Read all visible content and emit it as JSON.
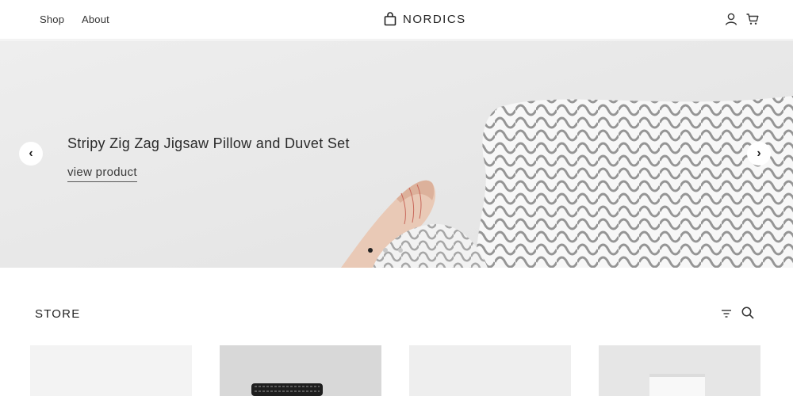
{
  "header": {
    "nav": [
      "Shop",
      "About"
    ],
    "brand": "NORDICS",
    "icons": [
      "shopping-bag-icon",
      "user-icon",
      "cart-icon"
    ]
  },
  "hero": {
    "title": "Stripy Zig Zag Jigsaw Pillow and Duvet Set",
    "link": "view product",
    "prev_glyph": "‹",
    "next_glyph": "›",
    "slides_count": 3,
    "active_slide": 1
  },
  "store": {
    "title": "STORE",
    "icons": [
      "filter-icon",
      "search-icon"
    ],
    "products_visible": 4
  },
  "colors": {
    "background": "#ffffff",
    "text": "#2b2b2b",
    "hero_bg": "#ebebeb",
    "active_dot": "#222222"
  }
}
